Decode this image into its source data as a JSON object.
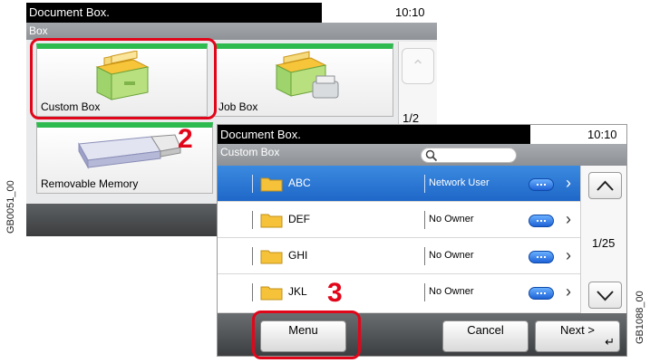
{
  "side_labels": {
    "left": "GB0051_00",
    "right": "GB1088_00"
  },
  "steps": {
    "step2": "2",
    "step3": "3"
  },
  "back_screen": {
    "title": "Document Box.",
    "time": "10:10",
    "subtitle": "Box",
    "tiles": [
      {
        "label": "Custom Box"
      },
      {
        "label": "Job Box"
      },
      {
        "label": "Removable Memory"
      }
    ],
    "page_indicator": "1/2"
  },
  "front_screen": {
    "title": "Document Box.",
    "time": "10:10",
    "subtitle": "Custom Box",
    "rows": [
      {
        "name": "ABC",
        "owner": "Network User",
        "selected": true
      },
      {
        "name": "DEF",
        "owner": "No Owner",
        "selected": false
      },
      {
        "name": "GHI",
        "owner": "No Owner",
        "selected": false
      },
      {
        "name": "JKL",
        "owner": "No Owner",
        "selected": false
      }
    ],
    "page_indicator": "1/25",
    "buttons": {
      "menu": "Menu",
      "cancel": "Cancel",
      "next": "Next >"
    }
  },
  "colors": {
    "highlight": "#e2061a",
    "tile_accent": "#2dbb4f",
    "selection": "#1f67c8"
  }
}
